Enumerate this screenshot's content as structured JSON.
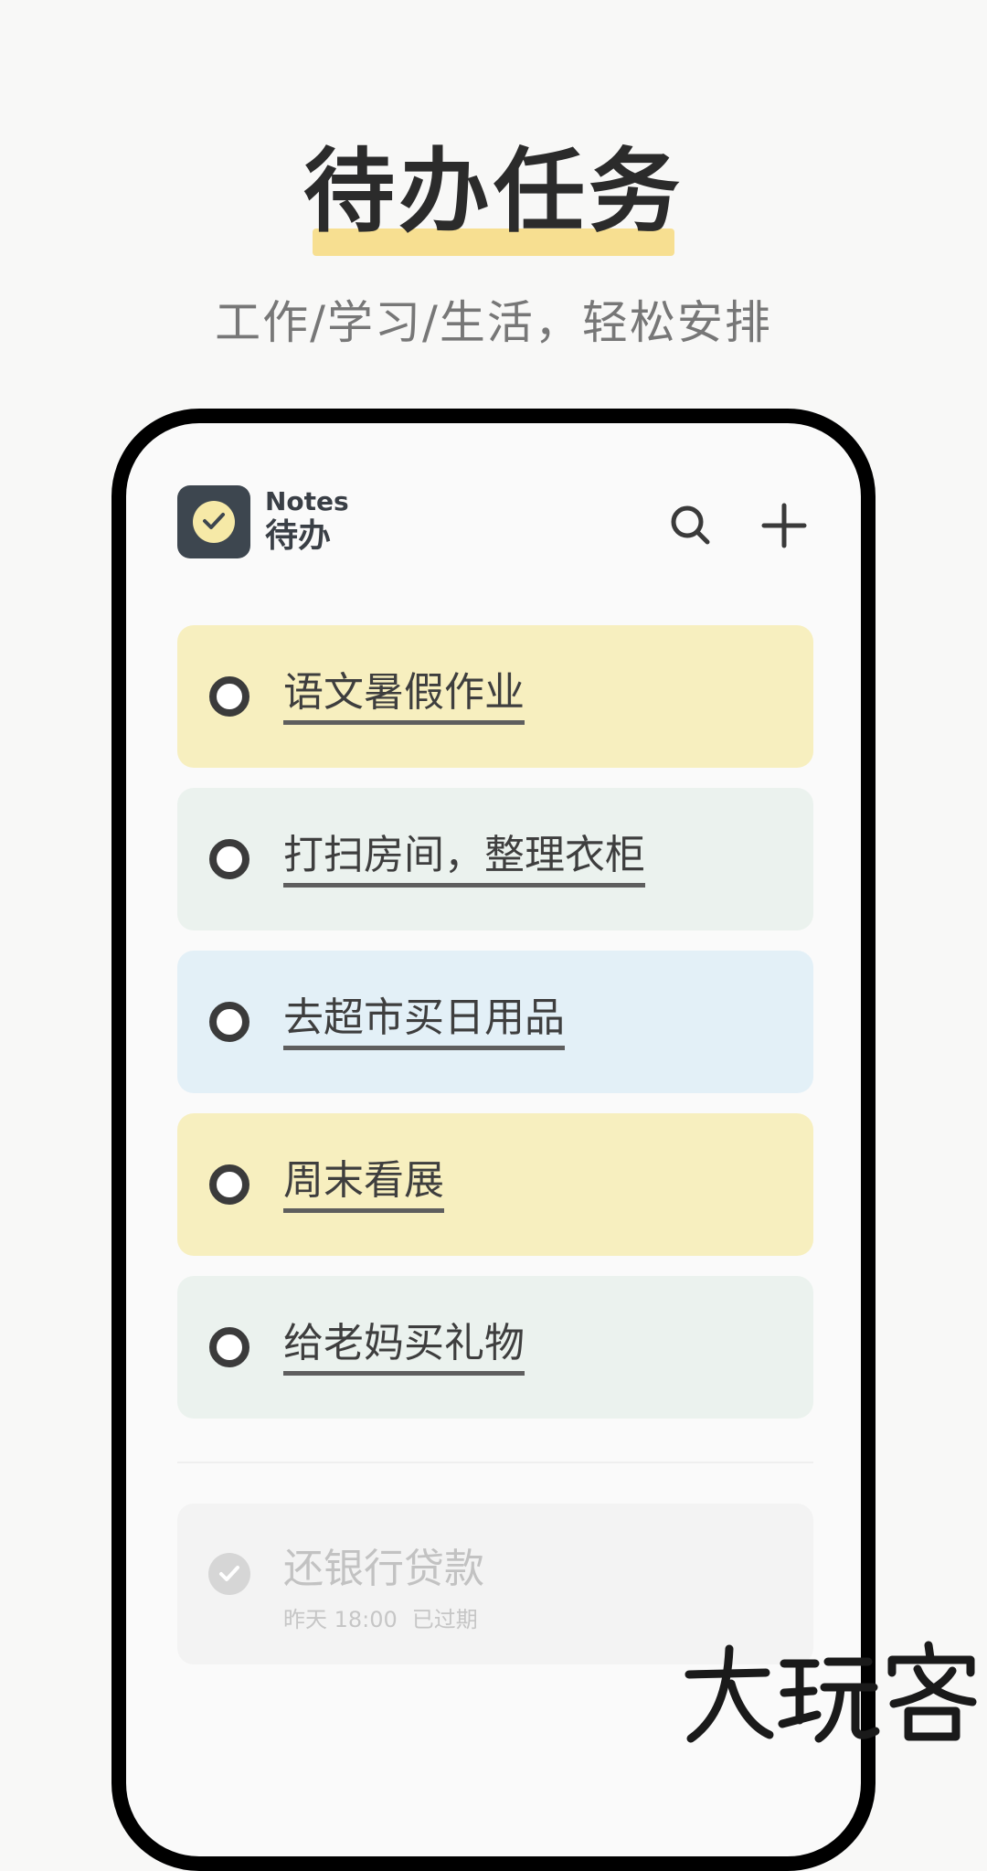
{
  "promo": {
    "title": "待办任务",
    "subtitle": "工作/学习/生活，轻松安排",
    "highlight_color": "#f7df91"
  },
  "app": {
    "name_en": "Notes",
    "name_cn": "待办",
    "logo_icon": "check-circle-icon",
    "search_icon": "search-icon",
    "add_icon": "plus-icon"
  },
  "tasks": [
    {
      "title": "语文暑假作业",
      "color": "#f7efbf",
      "done": false
    },
    {
      "title": "打扫房间，整理衣柜",
      "color": "#ebf2ee",
      "done": false
    },
    {
      "title": "去超市买日用品",
      "color": "#e3f0f7",
      "done": false
    },
    {
      "title": "周末看展",
      "color": "#f7efbf",
      "done": false
    },
    {
      "title": "给老妈买礼物",
      "color": "#ebf2ee",
      "done": false
    }
  ],
  "completed": {
    "title": "还银行贷款",
    "time": "昨天 18:00",
    "status": "已过期",
    "done": true
  },
  "watermark": "大玩客"
}
